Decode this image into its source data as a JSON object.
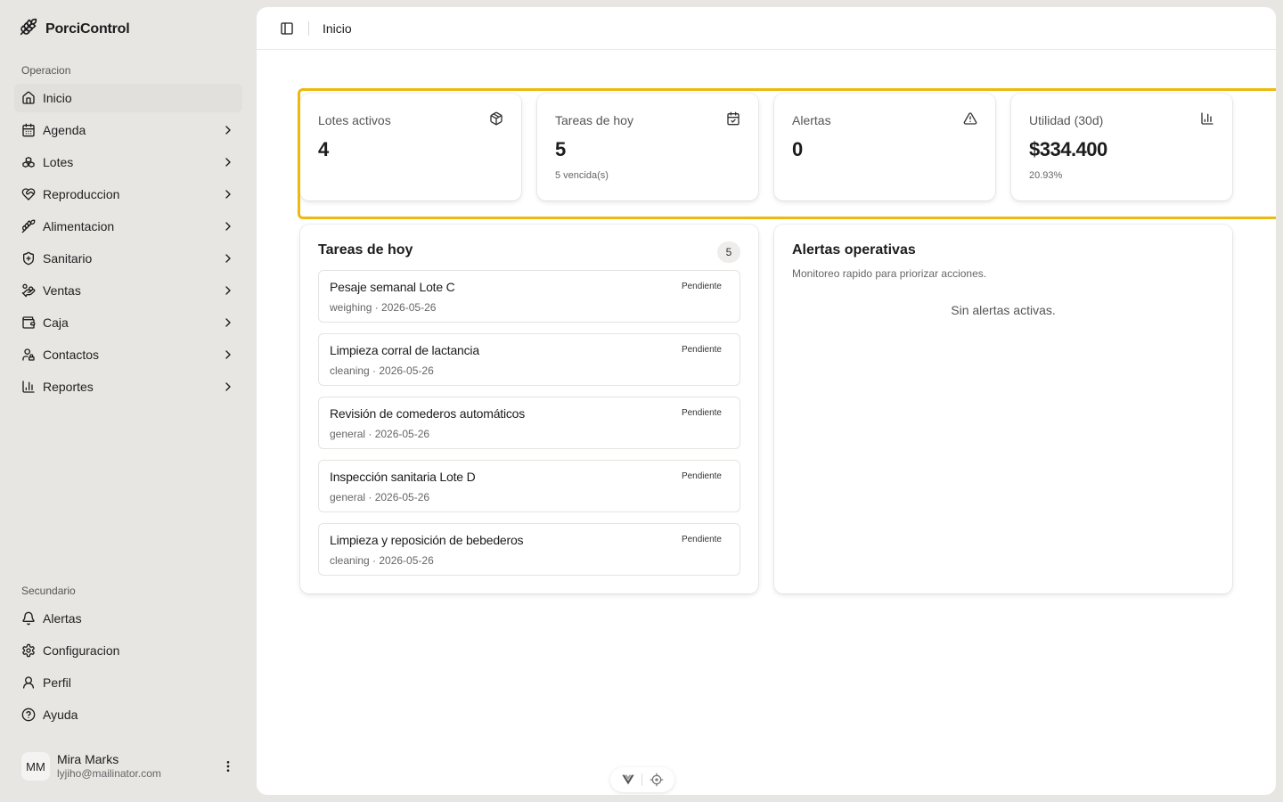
{
  "brand": {
    "name": "PorciControl",
    "icon": "farm-icon"
  },
  "sidebar": {
    "primary_label": "Operacion",
    "items": [
      {
        "label": "Inicio",
        "icon": "home-icon",
        "active": true,
        "chevron": false
      },
      {
        "label": "Agenda",
        "icon": "calendar-icon",
        "active": false,
        "chevron": true
      },
      {
        "label": "Lotes",
        "icon": "boxes-icon",
        "active": false,
        "chevron": true
      },
      {
        "label": "Reproduccion",
        "icon": "heart-handshake-icon",
        "active": false,
        "chevron": true
      },
      {
        "label": "Alimentacion",
        "icon": "wheat-icon",
        "active": false,
        "chevron": true
      },
      {
        "label": "Sanitario",
        "icon": "shield-plus-icon",
        "active": false,
        "chevron": true
      },
      {
        "label": "Ventas",
        "icon": "hand-coins-icon",
        "active": false,
        "chevron": true
      },
      {
        "label": "Caja",
        "icon": "wallet-icon",
        "active": false,
        "chevron": true
      },
      {
        "label": "Contactos",
        "icon": "contacts-icon",
        "active": false,
        "chevron": true
      },
      {
        "label": "Reportes",
        "icon": "bar-chart-icon",
        "active": false,
        "chevron": true
      }
    ],
    "secondary_label": "Secundario",
    "secondary_items": [
      {
        "label": "Alertas",
        "icon": "bell-icon"
      },
      {
        "label": "Configuracion",
        "icon": "settings-icon"
      },
      {
        "label": "Perfil",
        "icon": "user-icon"
      },
      {
        "label": "Ayuda",
        "icon": "help-circle-icon"
      }
    ],
    "user": {
      "initials": "MM",
      "name": "Mira Marks",
      "email": "lyjiho@mailinator.com"
    }
  },
  "header": {
    "breadcrumb": "Inicio"
  },
  "stats": [
    {
      "label": "Lotes activos",
      "value": "4",
      "sub": "",
      "icon": "package-icon"
    },
    {
      "label": "Tareas de hoy",
      "value": "5",
      "sub": "5 vencida(s)",
      "icon": "calendar-check-icon"
    },
    {
      "label": "Alertas",
      "value": "0",
      "sub": "",
      "icon": "alert-triangle-icon"
    },
    {
      "label": "Utilidad (30d)",
      "value": "$334.400",
      "sub": "20.93%",
      "icon": "chart-bars-icon"
    }
  ],
  "tasks": {
    "title": "Tareas de hoy",
    "count": "5",
    "items": [
      {
        "title": "Pesaje semanal Lote C",
        "meta": "weighing · 2026-05-26",
        "status": "Pendiente"
      },
      {
        "title": "Limpieza corral de lactancia",
        "meta": "cleaning · 2026-05-26",
        "status": "Pendiente"
      },
      {
        "title": "Revisión de comederos automáticos",
        "meta": "general · 2026-05-26",
        "status": "Pendiente"
      },
      {
        "title": "Inspección sanitaria Lote D",
        "meta": "general · 2026-05-26",
        "status": "Pendiente"
      },
      {
        "title": "Limpieza y reposición de bebederos",
        "meta": "cleaning · 2026-05-26",
        "status": "Pendiente"
      }
    ]
  },
  "alerts": {
    "title": "Alertas operativas",
    "description": "Monitoreo rapido para priorizar acciones.",
    "empty": "Sin alertas activas."
  },
  "colors": {
    "highlight": "#ecb90e",
    "sidebar_bg": "#e7e6e3",
    "active_item": "#e2e0dc"
  }
}
